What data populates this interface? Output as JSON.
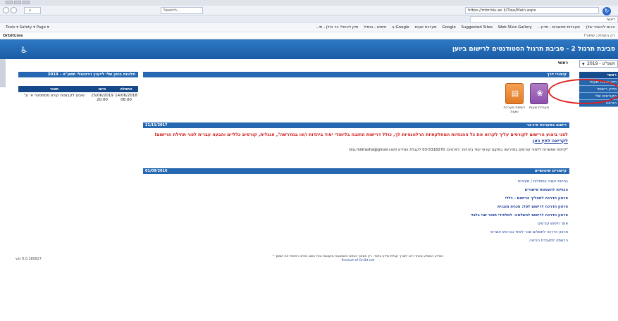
{
  "browser": {
    "url": "https://mbr.biu.ac.il/Tiqu/Main.aspx",
    "search_placeholder": "Search...",
    "quick_search": "- ρ",
    "active_tab": "ראשי",
    "favorites_tools": "Tools ▾ Safety ▾ Page ▾",
    "favorites_links": [
      "הכנס להאבד שלך",
      "מעבדות מחשבים - מדע...",
      "Google",
      "Suggested Sites",
      "Web Slice Gallery",
      "מערכת שעות",
      "Google-ב",
      "חיפוש - בנפיל",
      "תיק דיגיטלי בר אילן - תי..."
    ],
    "status_left": "OrbitLive",
    "status_right": "רק התחזק: שיפור?"
  },
  "site": {
    "title": "סביבת תרגול 2 - סביבת תרגול הסטודנטים לרישום ביוען",
    "accessibility_icon": "wheelchair-icon"
  },
  "sidebar": {
    "year": "תשפ\"ט - 2019",
    "items": [
      "ראשי",
      "תיק ישיבת שעות",
      "מידע רישומי",
      "הקורסים שלי",
      "הוראה"
    ]
  },
  "breadcrumb": "ראשי",
  "quick_links": {
    "header": "קיצורי דרך",
    "tiles": [
      {
        "label": "מערכת שעות",
        "icon": "gear-icon"
      },
      {
        "label": "רשימת מערכת שעות",
        "icon": "document-icon"
      }
    ]
  },
  "registration": {
    "header": "רישום במערכת אינ-בר",
    "date": "21/11/2017",
    "warning": "לפני ביצוע הרישום לקורסים עליך לקרוא את כל ההנחיות המחלקתיות הרלוונטיות לך, כולל דרישות החובה בלימודי יסוד ביהדות ו/או במדרשה\", אנגלית, קורסים כלליים והבעה עברית לפני תחילת הרישום!",
    "warning_link": "לקריאה לחץ כאן",
    "contact": "*קיימת אפשרות ללמוד קורסים במדרשה בפקום קורסי יסוד ביהדות. לפרטים: 03-5318270 לקבלת המידע biu.midrasha@gmail.com"
  },
  "useful_links": {
    "header": "קישורים שימושיים",
    "date": "01/09/2016",
    "items": [
      "בחינות וישובי בפוחלות / מעזרות",
      "הנחיות להעמסת אישורים",
      "סרטון הדרכה לתהליך הרישום - כללי",
      "סרטון הדרכה לרישום לפל: תכנית מובנית",
      "סרטון הדרכה לרישום להשלמה- למלפידי תואר שני בלבד",
      "אתר חיפוש קורסים",
      "סרטון הדרכה לתשלום שכר לימוד בכרטיס אשראי",
      "הרשמה למעבדת הוראה"
    ]
  },
  "footer": {
    "note": "* המידע המופיע באתר הינו לצורך קבלת מידע בלבד. רק מסמך הטפס האמצעות מקוננות בעל הסוג מחייב ראשית את הסמך",
    "product": "Product of Or-Bit.net",
    "version": "ver 6.0.180627"
  },
  "timetable": {
    "header": "חלונות הזמן שלי לייעוץ וירטואלי תשע\"ט - 2019",
    "columns": [
      "התחלה",
      "סיום",
      "תאור"
    ],
    "rows": [
      {
        "start": "14/06/2018 08:00",
        "end": "15/06/2019 20:00",
        "desc": "שיבוץ לקבוצות קורס מסמסטר א' וב'"
      }
    ]
  }
}
